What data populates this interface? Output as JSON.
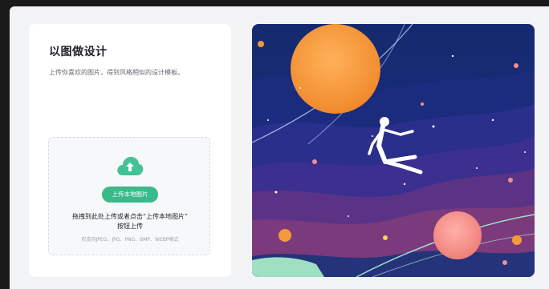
{
  "panel": {
    "title": "以图做设计",
    "subtitle": "上传你喜欢的图片，得到风格相似的设计模板。"
  },
  "upload": {
    "icon": "cloud-upload-icon",
    "button_label": "上传本地图片",
    "drop_hint_line1": "拖拽到此处上传或者点击“上传本地图片”",
    "drop_hint_line2": "按钮上传",
    "format_hint": "仅支持JPEG、JPG、PNG、BMP、WEBP格式"
  },
  "illustration": {
    "subject": "space-illustration-astronaut-planets"
  },
  "colors": {
    "accent": "#3ab98a",
    "panel_bg": "#ffffff",
    "dialog_bg": "#f2f3f5"
  }
}
